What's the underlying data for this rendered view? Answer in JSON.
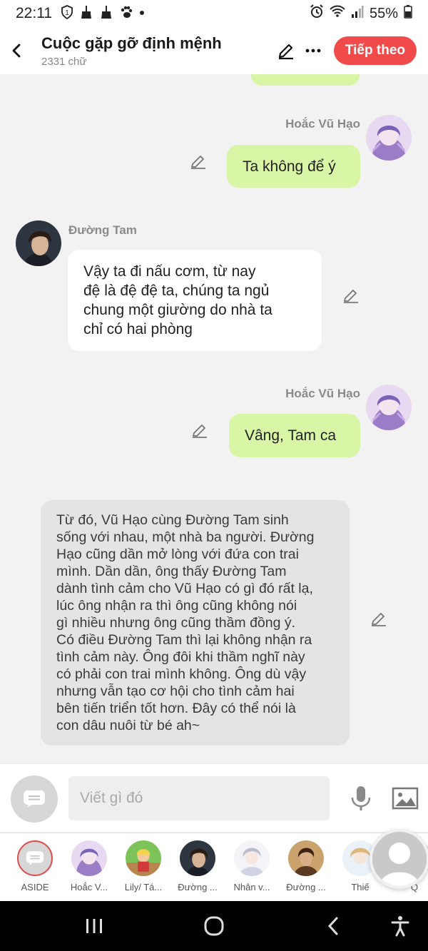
{
  "status": {
    "time": "22:11",
    "left_icons": [
      "sim-1-icon",
      "broom-icon",
      "broom-icon",
      "paw-icon",
      "dot-icon"
    ],
    "battery": "55%"
  },
  "header": {
    "title": "Cuộc gặp gỡ định mệnh",
    "subtitle": "2331 chữ",
    "next_label": "Tiếp theo"
  },
  "messages": [
    {
      "speaker": "Hoắc Vũ Hạo",
      "side": "right",
      "text": "Ta không để ý"
    },
    {
      "speaker": "Đường Tam",
      "side": "left",
      "lines": [
        "Vậy ta đi nấu cơm, từ nay",
        "đệ là đệ đệ ta, chúng ta ngủ",
        "chung một giường do nhà ta",
        "chỉ có hai phòng"
      ]
    },
    {
      "speaker": "Hoắc Vũ Hạo",
      "side": "right",
      "text": "Vâng, Tam ca"
    },
    {
      "speaker": "",
      "side": "narration",
      "lines": [
        "Từ đó, Vũ Hạo cùng Đường Tam sinh",
        "sống với nhau, một nhà ba người. Đường",
        "Hạo cũng dần mở lòng với đứa con trai",
        "mình. Dần dần, ông thấy Đường Tam",
        "dành tình cảm cho Vũ Hạo có gì đó rất lạ,",
        "lúc ông nhận ra thì ông cũng không nói",
        "gì nhiều nhưng ông cũng thầm đồng ý.",
        "Có điều Đường Tam thì lại không nhận ra",
        "tình cảm này. Ông đôi khi thầm nghĩ này",
        "có phải con trai mình không. Ông dù vậy",
        "nhưng vẫn tạo cơ hội cho tình cảm hai",
        "bên tiến triển tốt hơn. Đây có thể nói là",
        "con dâu nuôi từ bé ah~"
      ]
    }
  ],
  "composer": {
    "placeholder": "Viết gì đó"
  },
  "characters": [
    {
      "label": "ASIDE"
    },
    {
      "label": "Hoắc V..."
    },
    {
      "label": "Lily/ Tá..."
    },
    {
      "label": "Đường ..."
    },
    {
      "label": "Nhân v..."
    },
    {
      "label": "Đường ..."
    },
    {
      "label": "Thiế"
    },
    {
      "label": "Q"
    }
  ],
  "colors": {
    "accent": "#f04a4a",
    "user_bubble": "#d9f5a6",
    "narration_bubble": "#e4e4e4"
  }
}
